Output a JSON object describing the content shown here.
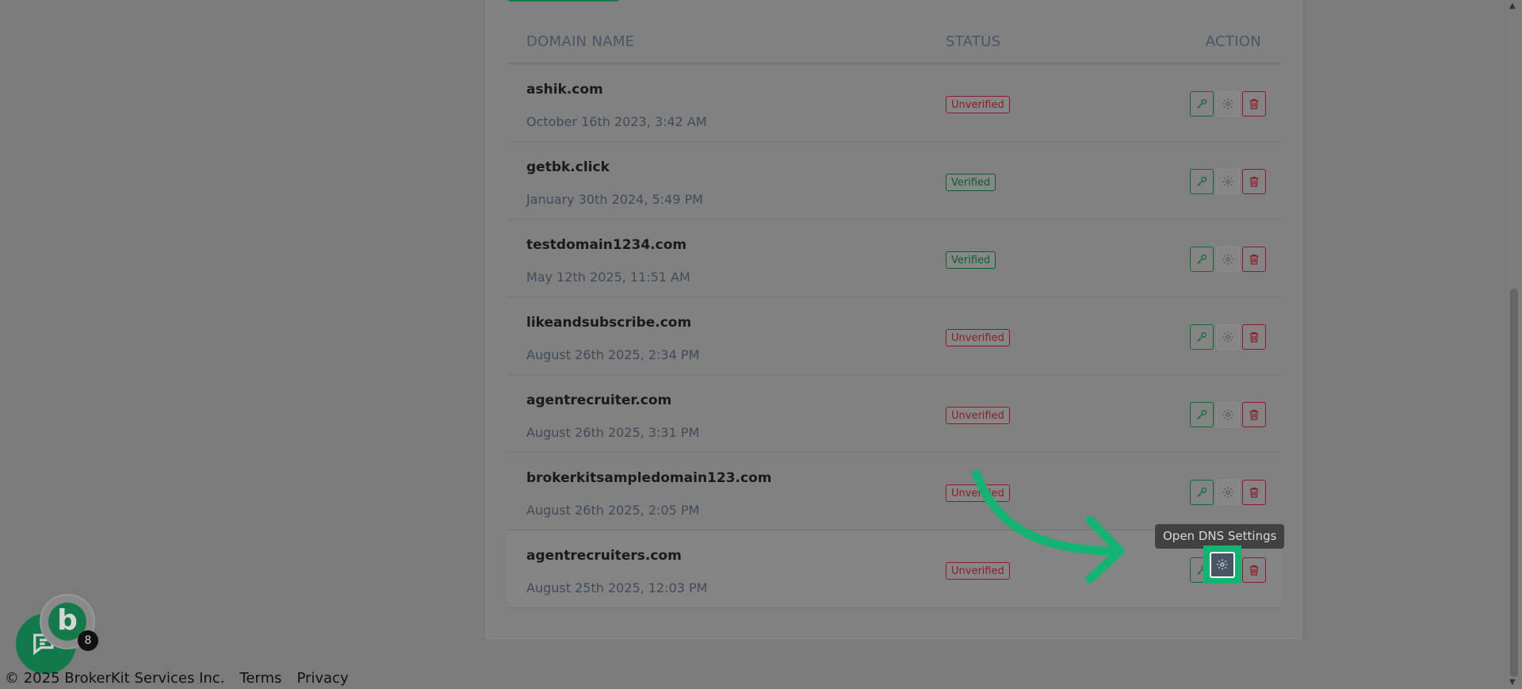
{
  "table": {
    "headers": {
      "domain": "DOMAIN NAME",
      "status": "STATUS",
      "action": "ACTION"
    },
    "rows": [
      {
        "domain": "ashik.com",
        "date": "October 16th 2023, 3:42 AM",
        "status": "Unverified"
      },
      {
        "domain": "getbk.click",
        "date": "January 30th 2024, 5:49 PM",
        "status": "Verified"
      },
      {
        "domain": "testdomain1234.com",
        "date": "May 12th 2025, 11:51 AM",
        "status": "Verified"
      },
      {
        "domain": "likeandsubscribe.com",
        "date": "August 26th 2025, 2:34 PM",
        "status": "Unverified"
      },
      {
        "domain": "agentrecruiter.com",
        "date": "August 26th 2025, 3:31 PM",
        "status": "Unverified"
      },
      {
        "domain": "brokerkitsampledomain123.com",
        "date": "August 26th 2025, 2:05 PM",
        "status": "Unverified"
      },
      {
        "domain": "agentrecruiters.com",
        "date": "August 25th 2025, 12:03 PM",
        "status": "Unverified"
      }
    ]
  },
  "tooltip": {
    "text": "Open DNS Settings"
  },
  "footer": {
    "copyright": "© 2025 BrokerKit Services Inc.",
    "terms": "Terms",
    "privacy": "Privacy"
  },
  "chat": {
    "avatar_letter": "b",
    "unread_count": "8"
  },
  "icons": {
    "key": "key-icon",
    "gear": "gear-icon",
    "trash": "trash-icon",
    "chat": "chat-icon"
  },
  "colors": {
    "accent": "#14b373",
    "verified": "#0c5c36",
    "unverified": "#8c1d28"
  }
}
